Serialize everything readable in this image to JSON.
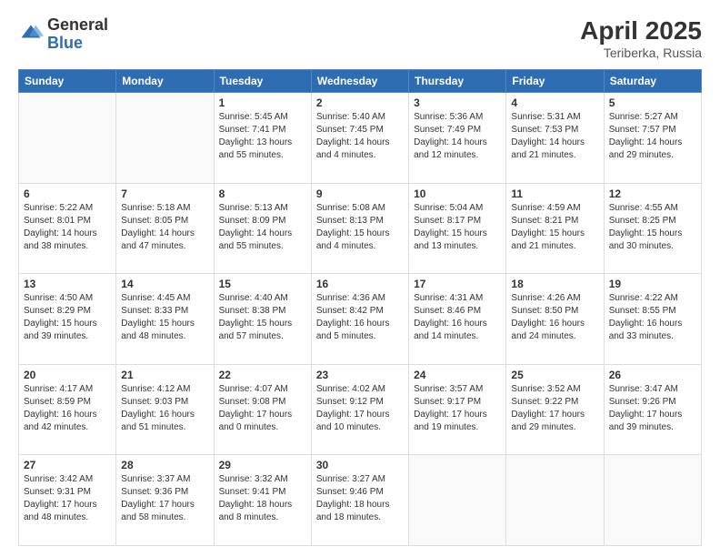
{
  "header": {
    "logo_general": "General",
    "logo_blue": "Blue",
    "title": "April 2025",
    "subtitle": "Teriberka, Russia"
  },
  "columns": [
    "Sunday",
    "Monday",
    "Tuesday",
    "Wednesday",
    "Thursday",
    "Friday",
    "Saturday"
  ],
  "weeks": [
    [
      {
        "day": "",
        "info": ""
      },
      {
        "day": "",
        "info": ""
      },
      {
        "day": "1",
        "info": "Sunrise: 5:45 AM\nSunset: 7:41 PM\nDaylight: 13 hours and 55 minutes."
      },
      {
        "day": "2",
        "info": "Sunrise: 5:40 AM\nSunset: 7:45 PM\nDaylight: 14 hours and 4 minutes."
      },
      {
        "day": "3",
        "info": "Sunrise: 5:36 AM\nSunset: 7:49 PM\nDaylight: 14 hours and 12 minutes."
      },
      {
        "day": "4",
        "info": "Sunrise: 5:31 AM\nSunset: 7:53 PM\nDaylight: 14 hours and 21 minutes."
      },
      {
        "day": "5",
        "info": "Sunrise: 5:27 AM\nSunset: 7:57 PM\nDaylight: 14 hours and 29 minutes."
      }
    ],
    [
      {
        "day": "6",
        "info": "Sunrise: 5:22 AM\nSunset: 8:01 PM\nDaylight: 14 hours and 38 minutes."
      },
      {
        "day": "7",
        "info": "Sunrise: 5:18 AM\nSunset: 8:05 PM\nDaylight: 14 hours and 47 minutes."
      },
      {
        "day": "8",
        "info": "Sunrise: 5:13 AM\nSunset: 8:09 PM\nDaylight: 14 hours and 55 minutes."
      },
      {
        "day": "9",
        "info": "Sunrise: 5:08 AM\nSunset: 8:13 PM\nDaylight: 15 hours and 4 minutes."
      },
      {
        "day": "10",
        "info": "Sunrise: 5:04 AM\nSunset: 8:17 PM\nDaylight: 15 hours and 13 minutes."
      },
      {
        "day": "11",
        "info": "Sunrise: 4:59 AM\nSunset: 8:21 PM\nDaylight: 15 hours and 21 minutes."
      },
      {
        "day": "12",
        "info": "Sunrise: 4:55 AM\nSunset: 8:25 PM\nDaylight: 15 hours and 30 minutes."
      }
    ],
    [
      {
        "day": "13",
        "info": "Sunrise: 4:50 AM\nSunset: 8:29 PM\nDaylight: 15 hours and 39 minutes."
      },
      {
        "day": "14",
        "info": "Sunrise: 4:45 AM\nSunset: 8:33 PM\nDaylight: 15 hours and 48 minutes."
      },
      {
        "day": "15",
        "info": "Sunrise: 4:40 AM\nSunset: 8:38 PM\nDaylight: 15 hours and 57 minutes."
      },
      {
        "day": "16",
        "info": "Sunrise: 4:36 AM\nSunset: 8:42 PM\nDaylight: 16 hours and 5 minutes."
      },
      {
        "day": "17",
        "info": "Sunrise: 4:31 AM\nSunset: 8:46 PM\nDaylight: 16 hours and 14 minutes."
      },
      {
        "day": "18",
        "info": "Sunrise: 4:26 AM\nSunset: 8:50 PM\nDaylight: 16 hours and 24 minutes."
      },
      {
        "day": "19",
        "info": "Sunrise: 4:22 AM\nSunset: 8:55 PM\nDaylight: 16 hours and 33 minutes."
      }
    ],
    [
      {
        "day": "20",
        "info": "Sunrise: 4:17 AM\nSunset: 8:59 PM\nDaylight: 16 hours and 42 minutes."
      },
      {
        "day": "21",
        "info": "Sunrise: 4:12 AM\nSunset: 9:03 PM\nDaylight: 16 hours and 51 minutes."
      },
      {
        "day": "22",
        "info": "Sunrise: 4:07 AM\nSunset: 9:08 PM\nDaylight: 17 hours and 0 minutes."
      },
      {
        "day": "23",
        "info": "Sunrise: 4:02 AM\nSunset: 9:12 PM\nDaylight: 17 hours and 10 minutes."
      },
      {
        "day": "24",
        "info": "Sunrise: 3:57 AM\nSunset: 9:17 PM\nDaylight: 17 hours and 19 minutes."
      },
      {
        "day": "25",
        "info": "Sunrise: 3:52 AM\nSunset: 9:22 PM\nDaylight: 17 hours and 29 minutes."
      },
      {
        "day": "26",
        "info": "Sunrise: 3:47 AM\nSunset: 9:26 PM\nDaylight: 17 hours and 39 minutes."
      }
    ],
    [
      {
        "day": "27",
        "info": "Sunrise: 3:42 AM\nSunset: 9:31 PM\nDaylight: 17 hours and 48 minutes."
      },
      {
        "day": "28",
        "info": "Sunrise: 3:37 AM\nSunset: 9:36 PM\nDaylight: 17 hours and 58 minutes."
      },
      {
        "day": "29",
        "info": "Sunrise: 3:32 AM\nSunset: 9:41 PM\nDaylight: 18 hours and 8 minutes."
      },
      {
        "day": "30",
        "info": "Sunrise: 3:27 AM\nSunset: 9:46 PM\nDaylight: 18 hours and 18 minutes."
      },
      {
        "day": "",
        "info": ""
      },
      {
        "day": "",
        "info": ""
      },
      {
        "day": "",
        "info": ""
      }
    ]
  ]
}
